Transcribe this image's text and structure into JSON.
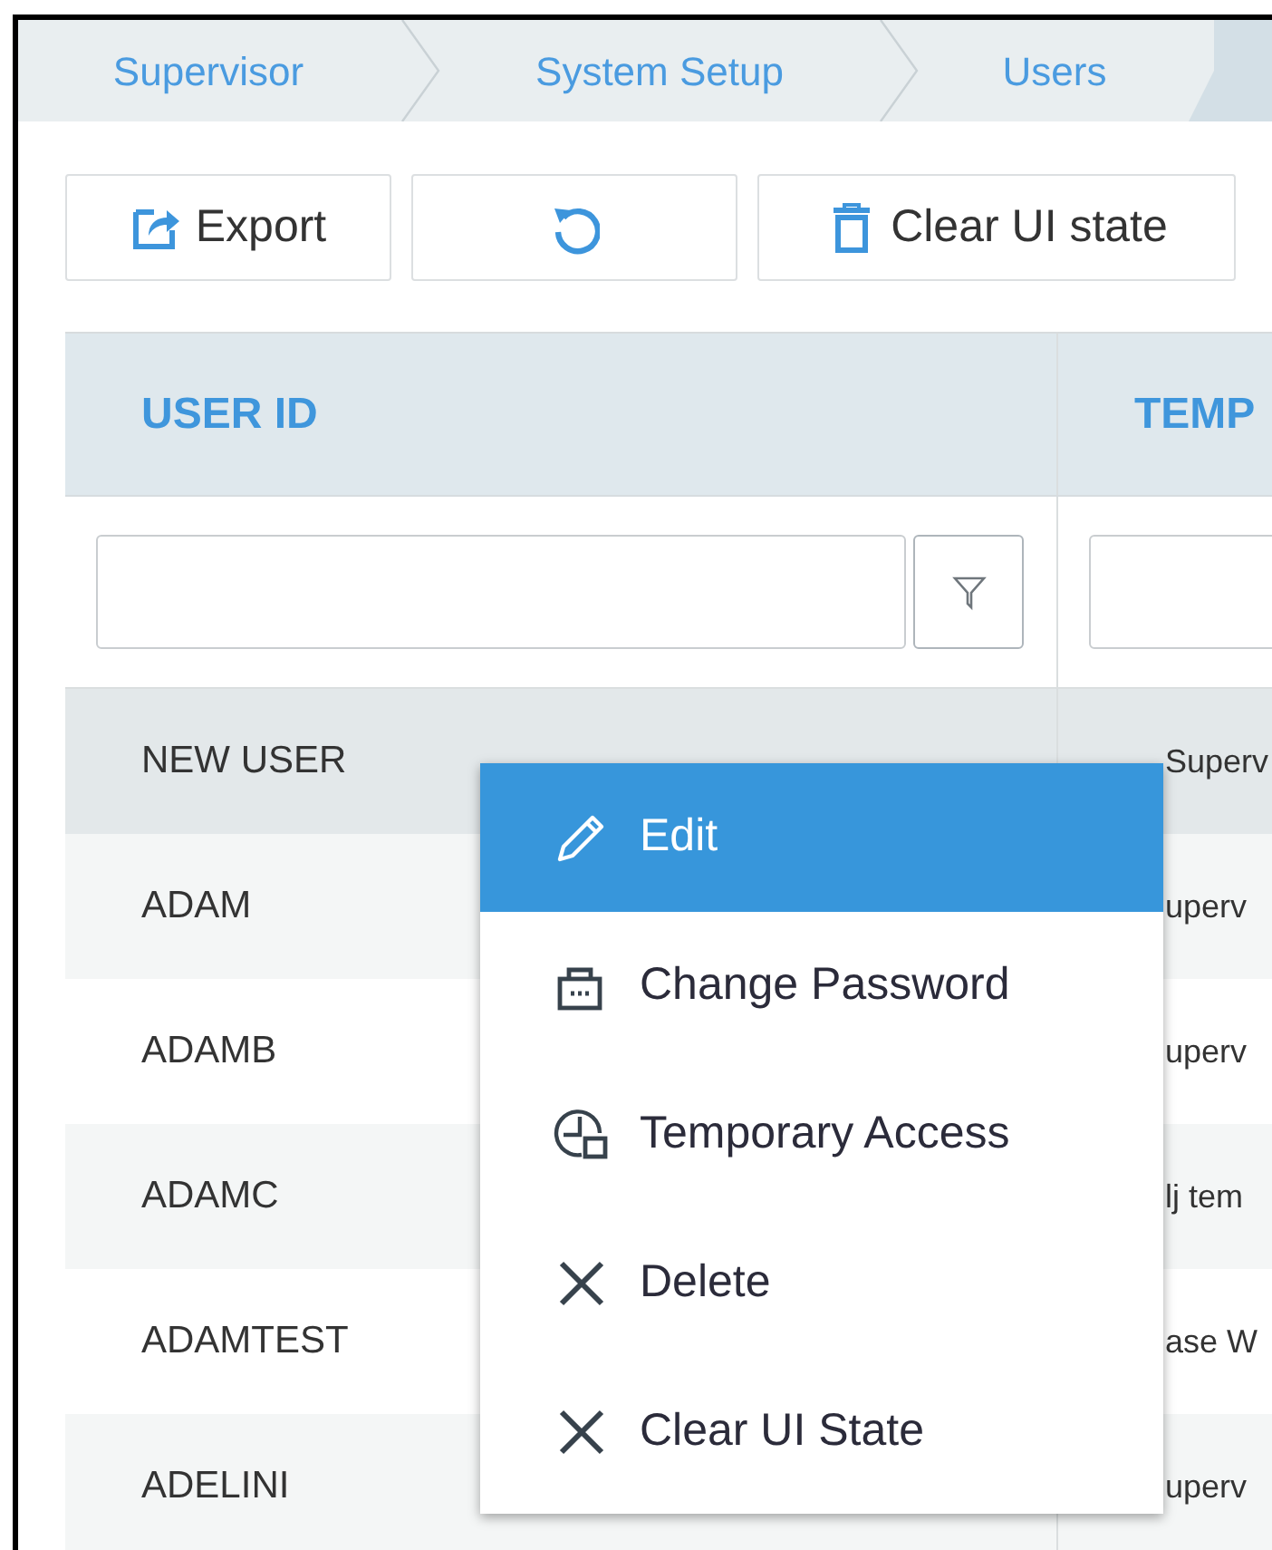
{
  "breadcrumb": [
    {
      "label": "Supervisor"
    },
    {
      "label": "System Setup"
    },
    {
      "label": "Users"
    }
  ],
  "toolbar": [
    {
      "kind": "export",
      "label": "Export"
    },
    {
      "kind": "refresh"
    },
    {
      "kind": "trash",
      "label": "Clear UI state"
    }
  ],
  "table": {
    "columns": [
      "USER ID",
      "TEMP"
    ],
    "rows": [
      {
        "selected": true,
        "cells": [
          "NEW USER",
          "Superv"
        ]
      },
      {
        "selected": false,
        "cells": [
          "ADAM",
          "uperv"
        ]
      },
      {
        "selected": false,
        "cells": [
          "ADAMB",
          "uperv"
        ]
      },
      {
        "selected": false,
        "cells": [
          "ADAMC",
          "lj tem"
        ]
      },
      {
        "selected": false,
        "cells": [
          "ADAMTEST",
          "ase W"
        ]
      },
      {
        "selected": false,
        "cells": [
          "ADELINI",
          "uperv"
        ]
      }
    ]
  },
  "context_menu": [
    {
      "kind": "pencil",
      "label": "Edit",
      "selected": true
    },
    {
      "kind": "lock",
      "label": "Change Password",
      "selected": false
    },
    {
      "kind": "clock",
      "label": "Temporary Access",
      "selected": false
    },
    {
      "kind": "x",
      "label": "Delete",
      "selected": false
    },
    {
      "kind": "x",
      "label": "Clear UI State",
      "selected": false
    }
  ]
}
